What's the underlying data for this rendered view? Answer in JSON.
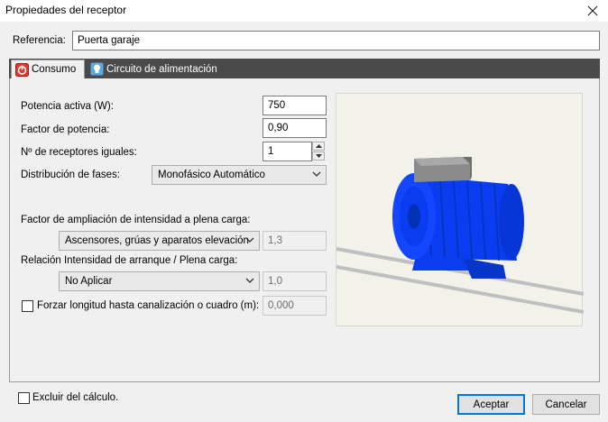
{
  "window": {
    "title": "Propiedades del receptor"
  },
  "referencia": {
    "label": "Referencia:",
    "value": "Puerta garaje"
  },
  "tabs": [
    {
      "label": "Consumo",
      "icon": "power-icon",
      "active": true
    },
    {
      "label": "Circuito de alimentación",
      "icon": "bulb-icon",
      "active": false
    }
  ],
  "consumo": {
    "potencia": {
      "label": "Potencia activa (W):",
      "value": "750"
    },
    "factor": {
      "label": "Factor de potencia:",
      "value": "0,90"
    },
    "receptores": {
      "label": "Nº de receptores iguales:",
      "value": "1"
    },
    "fases": {
      "label": "Distribución de fases:",
      "selected": "Monofásico Automático"
    },
    "ampliacion": {
      "label": "Factor de ampliación de intensidad a plena carga:",
      "selected": "Ascensores, grúas y aparatos elevación",
      "value": "1,3"
    },
    "arranque": {
      "label": "Relación Intensidad de arranque / Plena carga:",
      "selected": "No Aplicar",
      "value": "1,0"
    },
    "forzar": {
      "label": "Forzar longitud hasta canalización o cuadro (m):",
      "checked": false,
      "value": "0,000"
    }
  },
  "footer": {
    "excluir": {
      "label": "Excluir del cálculo.",
      "checked": false
    },
    "aceptar": "Aceptar",
    "cancelar": "Cancelar"
  },
  "colors": {
    "tab_bar": "#4a4a4a",
    "motor_blue": "#0a3cf0",
    "motor_box": "#8a8a8a",
    "preview_bg": "#f2f1ea",
    "accent": "#0078d7"
  }
}
